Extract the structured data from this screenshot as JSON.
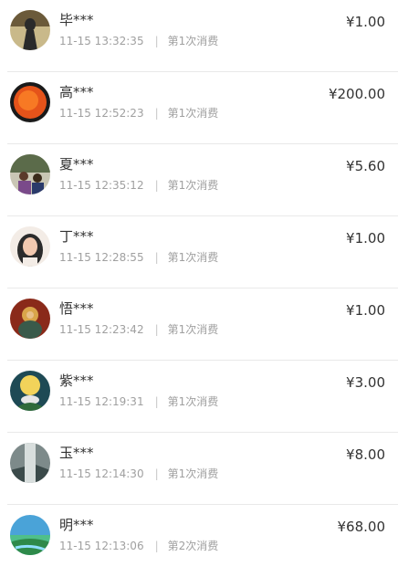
{
  "records": [
    {
      "name": "毕***",
      "time": "11-15 13:32:35",
      "divider": "|",
      "count": "第1次消费",
      "amount": "¥1.00",
      "avatar_icon": "avatar-woman-dark-photo-icon",
      "colors": [
        "#6b5a3a",
        "#c9b98a",
        "#2a2a2a"
      ]
    },
    {
      "name": "高***",
      "time": "11-15 12:52:23",
      "divider": "|",
      "count": "第1次消费",
      "amount": "¥200.00",
      "avatar_icon": "avatar-sun-icon",
      "colors": [
        "#1a1a1a",
        "#e5531a",
        "#ff8a2a"
      ]
    },
    {
      "name": "夏***",
      "time": "11-15 12:35:12",
      "divider": "|",
      "count": "第1次消费",
      "amount": "¥5.60",
      "avatar_icon": "avatar-family-outdoor-icon",
      "colors": [
        "#5b6b4a",
        "#c9c6b4",
        "#7a4a8a"
      ]
    },
    {
      "name": "丁***",
      "time": "11-15 12:28:55",
      "divider": "|",
      "count": "第1次消费",
      "amount": "¥1.00",
      "avatar_icon": "avatar-woman-portrait-icon",
      "colors": [
        "#f3ece6",
        "#2b2b2b",
        "#f2c9b0"
      ]
    },
    {
      "name": "悟***",
      "time": "11-15 12:23:42",
      "divider": "|",
      "count": "第1次消费",
      "amount": "¥1.00",
      "avatar_icon": "avatar-deity-painting-icon",
      "colors": [
        "#8a2a1a",
        "#d9a54a",
        "#3a5a4a"
      ]
    },
    {
      "name": "紫***",
      "time": "11-15 12:19:31",
      "divider": "|",
      "count": "第1次消费",
      "amount": "¥3.00",
      "avatar_icon": "avatar-moon-lotus-icon",
      "colors": [
        "#1e4a55",
        "#f2d35a",
        "#e6e6e6"
      ]
    },
    {
      "name": "玉***",
      "time": "11-15 12:14:30",
      "divider": "|",
      "count": "第1次消费",
      "amount": "¥8.00",
      "avatar_icon": "avatar-waterfall-icon",
      "colors": [
        "#7d8a8a",
        "#d8dedd",
        "#3b4a4a"
      ]
    },
    {
      "name": "明***",
      "time": "11-15 12:13:06",
      "divider": "|",
      "count": "第2次消费",
      "amount": "¥68.00",
      "avatar_icon": "avatar-landscape-icon",
      "colors": [
        "#4aa3d8",
        "#4fbf8a",
        "#2e8a4a"
      ]
    }
  ]
}
